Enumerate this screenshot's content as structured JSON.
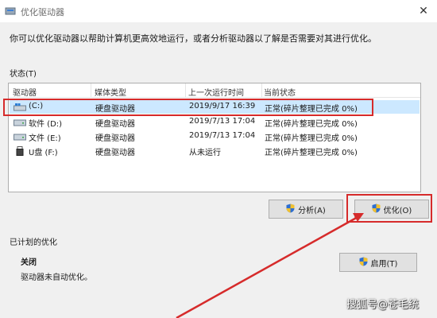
{
  "window": {
    "title": "优化驱动器"
  },
  "description": "你可以优化驱动器以帮助计算机更高效地运行，或者分析驱动器以了解是否需要对其进行优化。",
  "status_section": {
    "label": "状态(T)"
  },
  "table": {
    "columns": [
      "驱动器",
      "媒体类型",
      "上一次运行时间",
      "当前状态"
    ],
    "rows": [
      {
        "drive": "(C:)",
        "media": "硬盘驱动器",
        "last_run": "2019/9/17 16:39",
        "status": "正常(碎片整理已完成 0%)",
        "icon": "system-drive-icon",
        "selected": true
      },
      {
        "drive": "软件 (D:)",
        "media": "硬盘驱动器",
        "last_run": "2019/7/13 17:04",
        "status": "正常(碎片整理已完成 0%)",
        "icon": "hard-drive-icon",
        "selected": false
      },
      {
        "drive": "文件 (E:)",
        "media": "硬盘驱动器",
        "last_run": "2019/7/13 17:04",
        "status": "正常(碎片整理已完成 0%)",
        "icon": "hard-drive-icon",
        "selected": false
      },
      {
        "drive": "U盘 (F:)",
        "media": "硬盘驱动器",
        "last_run": "从未运行",
        "status": "正常(碎片整理已完成 0%)",
        "icon": "usb-drive-icon",
        "selected": false
      }
    ]
  },
  "buttons": {
    "analyze": "分析(A)",
    "optimize": "优化(O)",
    "enable": "启用(T)"
  },
  "scheduled": {
    "label": "已计划的优化",
    "state": "关闭",
    "detail": "驱动器未自动优化。"
  },
  "watermark": "搜狐号@苍毛统",
  "colors": {
    "highlight": "#d62b2b",
    "selection": "#cce8ff",
    "button": "#e1e1e1"
  }
}
